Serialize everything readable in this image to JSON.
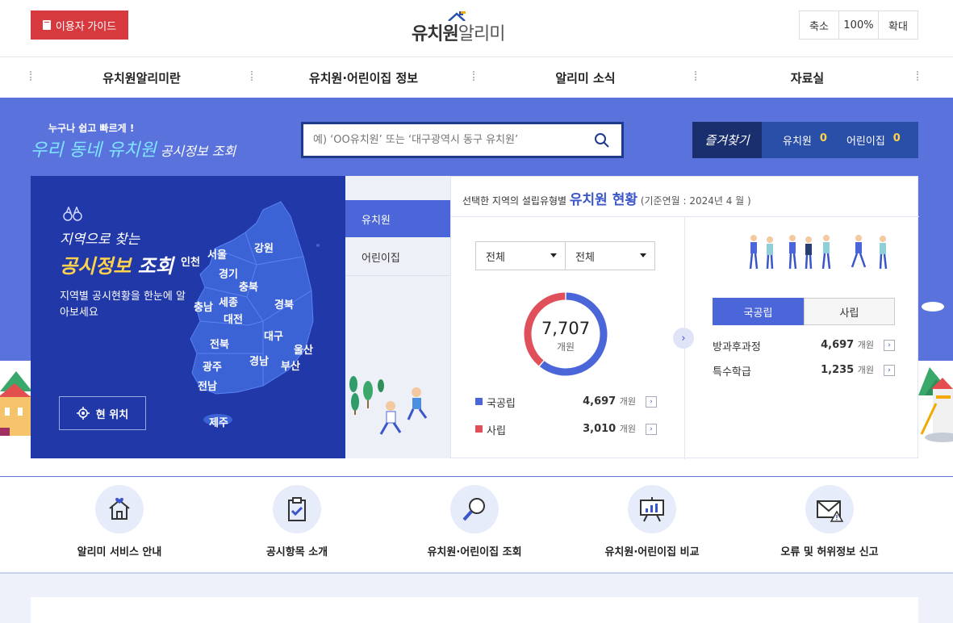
{
  "header": {
    "guide_label": "이용자 가이드",
    "logo_main": "유치원",
    "logo_light": "알리미",
    "zoom_out": "축소",
    "zoom_level": "100%",
    "zoom_in": "확대"
  },
  "nav": {
    "items": [
      {
        "label": "유치원알리미란"
      },
      {
        "label": "유치원·어린이집 정보"
      },
      {
        "label": "알리미 소식"
      },
      {
        "label": "자료실"
      }
    ]
  },
  "hero": {
    "slogan_sub": "누구나 쉽고 빠르게 !",
    "slogan_a": "우리 동네 ",
    "slogan_b": "유치원",
    "slogan_c": " 공시정보 조회",
    "search_placeholder": "예) ‘OO유치원’ 또는 ‘대구광역시 동구 유치원’",
    "fav_title": "즐겨찾기",
    "fav_kinder_label": "유치원",
    "fav_kinder_count": "0",
    "fav_daycare_label": "어린이집",
    "fav_daycare_count": "0"
  },
  "map": {
    "title1": "지역으로 찾는",
    "title2a": "공시정보",
    "title2b": " 조회",
    "desc": "지역별 공시현황을 한눈에 알아보세요",
    "location_label": "현 위치",
    "regions": [
      {
        "name": "서울"
      },
      {
        "name": "인천"
      },
      {
        "name": "강원"
      },
      {
        "name": "경기"
      },
      {
        "name": "충북"
      },
      {
        "name": "충남"
      },
      {
        "name": "세종"
      },
      {
        "name": "대전"
      },
      {
        "name": "경북"
      },
      {
        "name": "대구"
      },
      {
        "name": "전북"
      },
      {
        "name": "울산"
      },
      {
        "name": "광주"
      },
      {
        "name": "경남"
      },
      {
        "name": "부산"
      },
      {
        "name": "전남"
      },
      {
        "name": "제주"
      }
    ]
  },
  "tabs": [
    {
      "label": "유치원",
      "active": true
    },
    {
      "label": "어린이집",
      "active": false
    }
  ],
  "stats": {
    "head_pre": "선택한 지역의 설립유형별 ",
    "head_big": "유치원 현황",
    "head_date": " (기준연월 : 2024년 4 월 )",
    "select1": "전체",
    "select2": "전체",
    "total": "7,707",
    "total_unit": "개원",
    "public_label": "국공립",
    "public_value": "4,697",
    "private_label": "사립",
    "private_value": "3,010",
    "unit": "개원",
    "public_color": "#4b66d8",
    "private_color": "#e0505a",
    "type_tab_public": "국공립",
    "type_tab_private": "사립",
    "after_school_label": "방과후과정",
    "after_school_value": "4,697",
    "special_label": "특수학급",
    "special_value": "1,235"
  },
  "chart_data": {
    "type": "pie",
    "categories": [
      "국공립",
      "사립"
    ],
    "values": [
      4697,
      3010
    ],
    "title": "",
    "total": 7707
  },
  "quick": [
    {
      "label": "알리미 서비스 안내",
      "icon": "home-heart-icon"
    },
    {
      "label": "공시항목 소개",
      "icon": "clipboard-check-icon"
    },
    {
      "label": "유치원·어린이집 조회",
      "icon": "magnifier-icon"
    },
    {
      "label": "유치원·어린이집 비교",
      "icon": "chart-board-icon"
    },
    {
      "label": "오류 및 허위정보 신고",
      "icon": "mail-warning-icon"
    }
  ]
}
